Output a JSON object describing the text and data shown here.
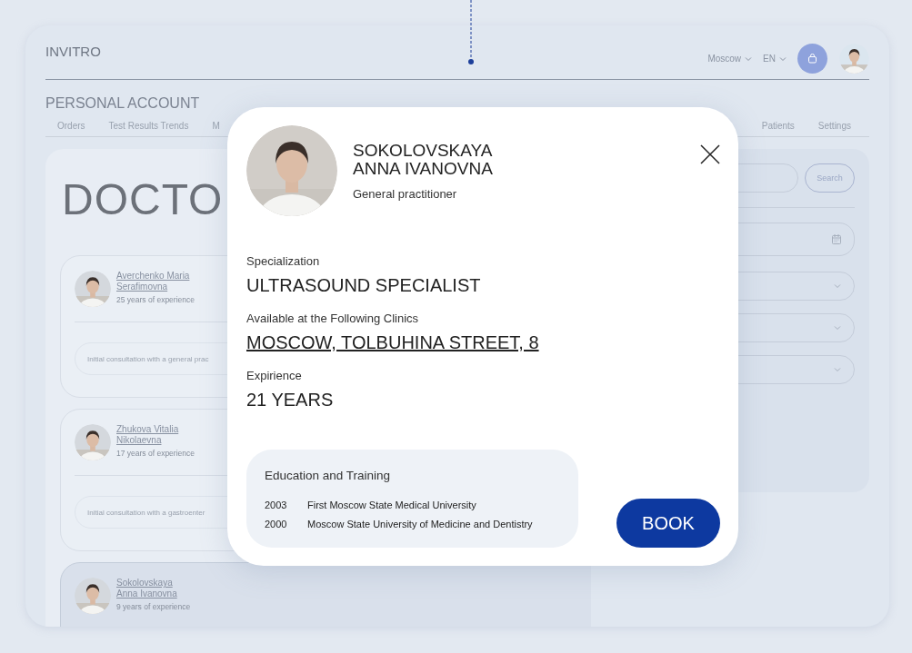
{
  "header": {
    "logo": "INVITRO",
    "city": "Moscow",
    "language": "EN"
  },
  "page_title": "PERSONAL ACCOUNT",
  "tabs": [
    {
      "label": "Orders",
      "selected": false
    },
    {
      "label": "Test Results Trends",
      "selected": false
    },
    {
      "label": "M",
      "selected": false
    },
    {
      "label": "Patients",
      "selected": false
    },
    {
      "label": "Settings",
      "selected": false
    }
  ],
  "doctors_panel": {
    "title": "DOCTO",
    "doctors": [
      {
        "name": "Averchenko Maria Serafimovna",
        "experience": "25 years of experience",
        "service": "Initial consultation with a general prac",
        "selected": false
      },
      {
        "name": "Zhukova Vitalia Nikolaevna",
        "experience": "17 years of experience",
        "service": "Initial consultation with a gastroenter",
        "selected": false
      },
      {
        "name": "Sokolovskaya Anna Ivanovna",
        "experience": "9 years of experience",
        "selected": true
      }
    ]
  },
  "filters": {
    "search_button": "Search"
  },
  "doctor_modal": {
    "name": "SOKOLOVSKAYA ANNA IVANOVNA",
    "position": "General practitioner",
    "fields": [
      {
        "kind": "text",
        "label": "Specialization",
        "value": "ULTRASOUND SPECIALIST"
      },
      {
        "kind": "link",
        "label": "Available at the Following Clinics",
        "value": "MOSCOW, TOLBUHINA STREET, 8"
      },
      {
        "kind": "text",
        "label": "Expirience",
        "value": "21 YEARS"
      }
    ],
    "education": {
      "title": "Education and Training",
      "entries": [
        {
          "year": "2003",
          "institution": "First Moscow State Medical University"
        },
        {
          "year": "2000",
          "institution": "Moscow State University of Medicine and Dentistry"
        }
      ]
    },
    "book_button": "BOOK"
  }
}
